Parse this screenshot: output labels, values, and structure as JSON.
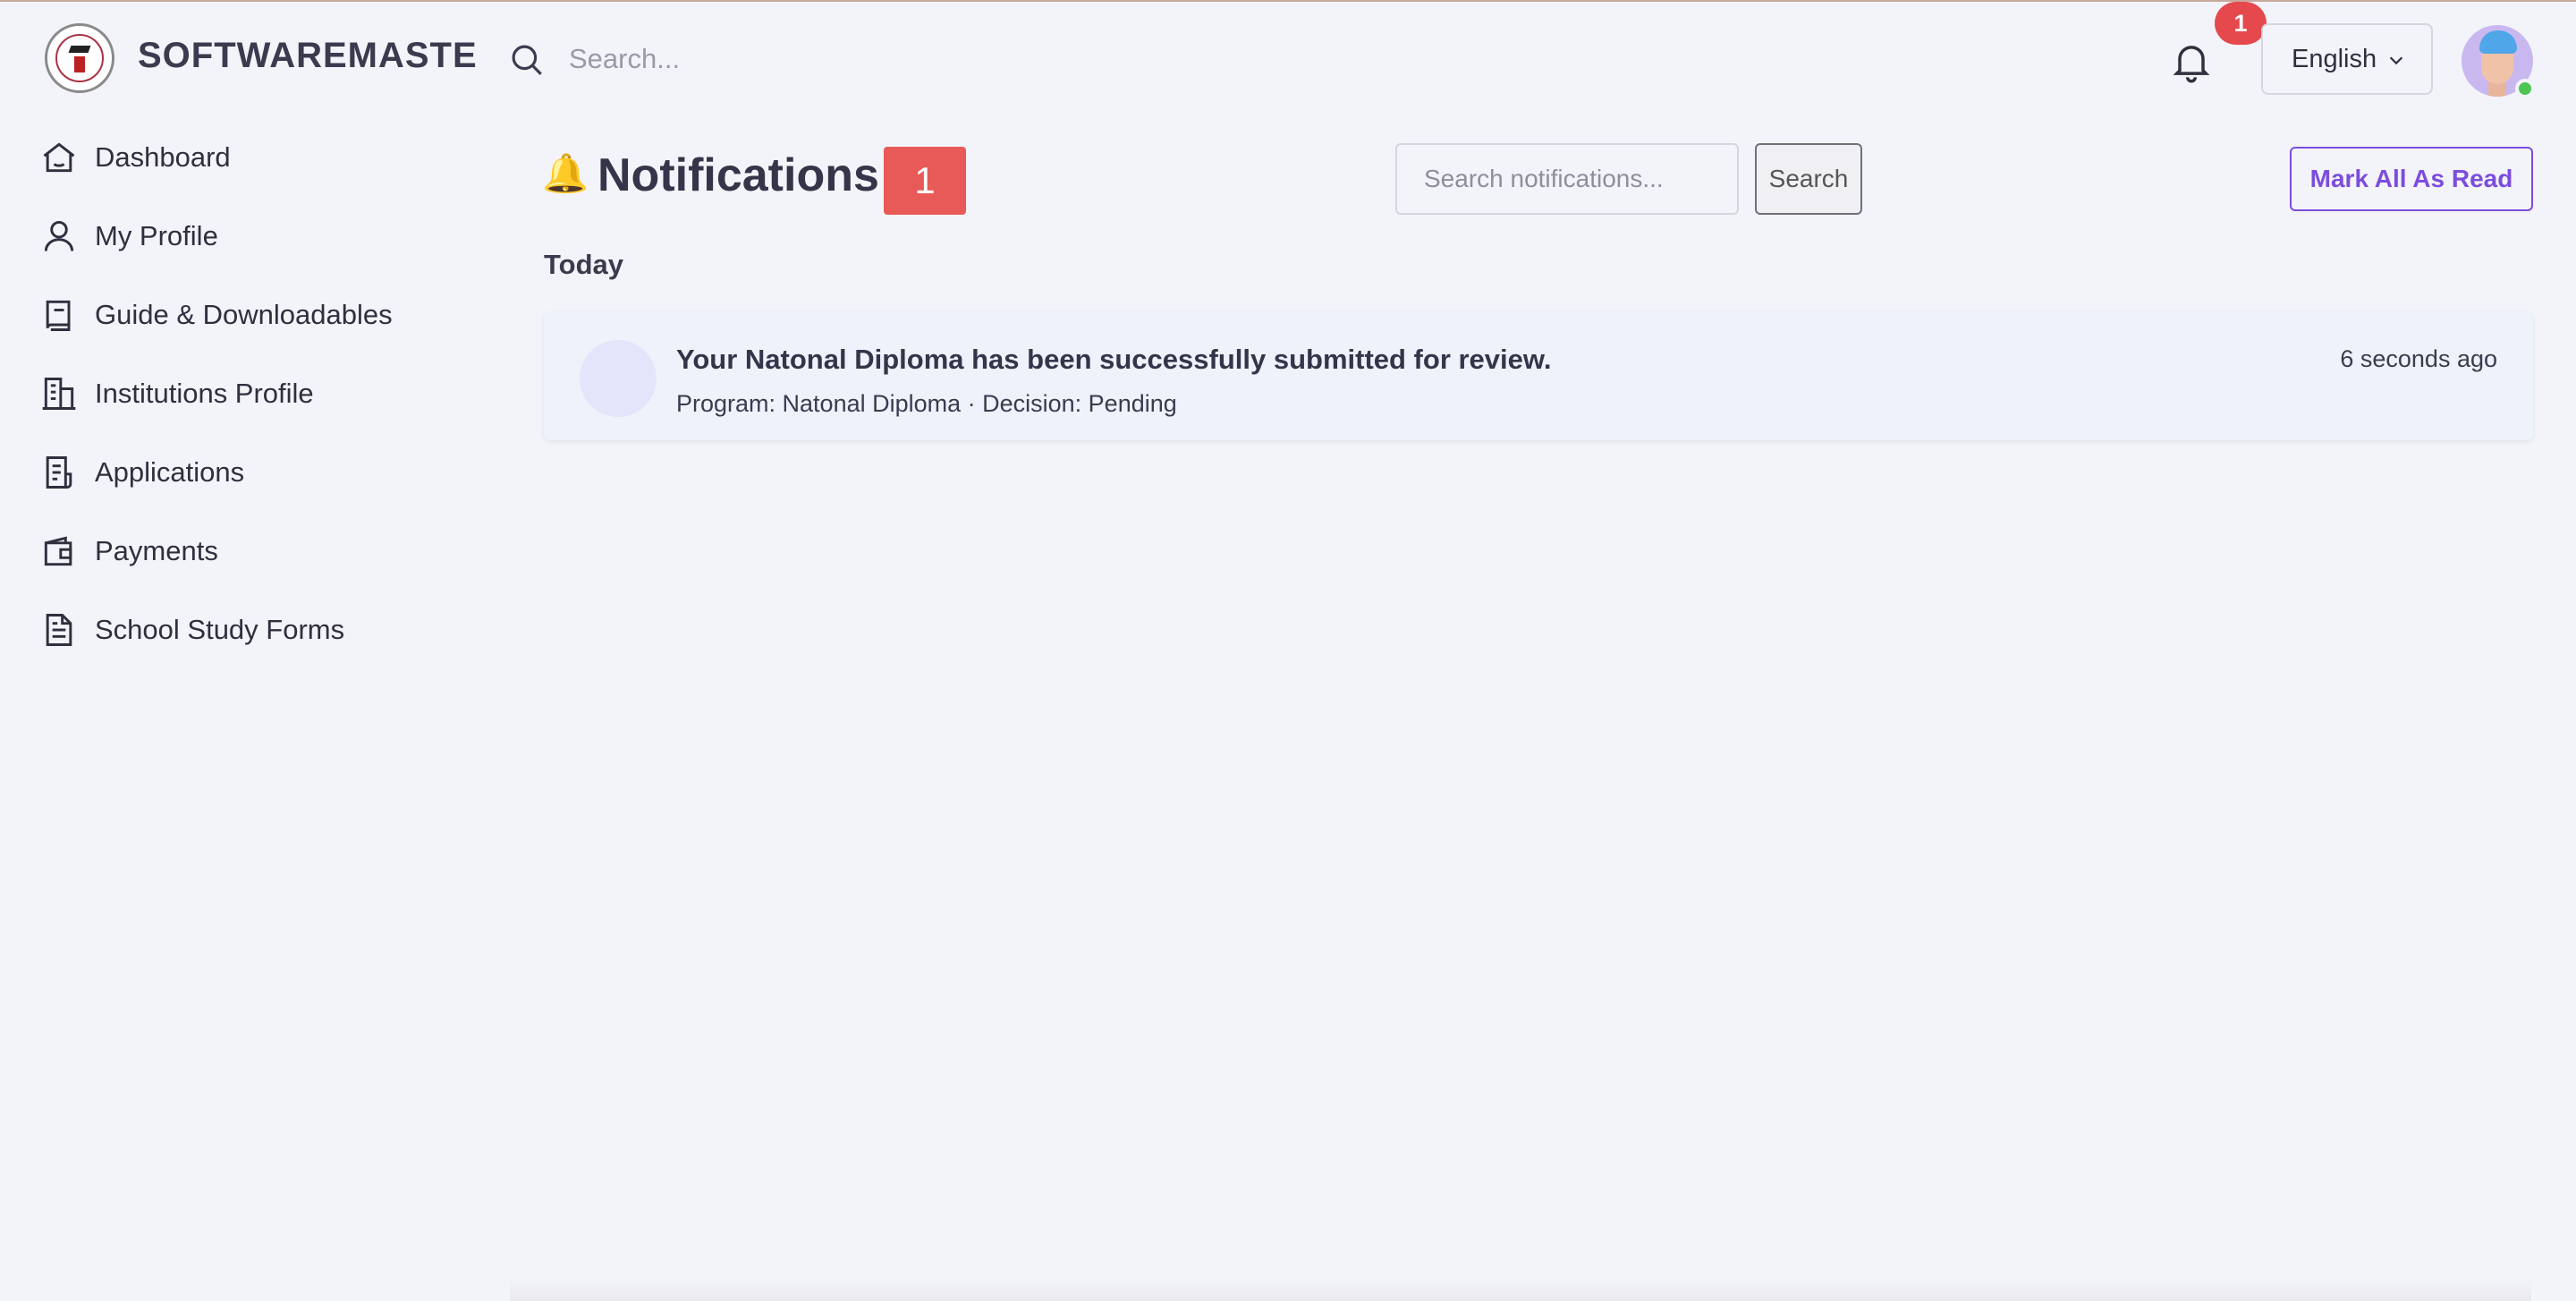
{
  "brand": {
    "name": "SOFTWAREMASTE",
    "logo_icon": "school-seal-logo"
  },
  "top_search": {
    "placeholder": "Search...",
    "icon": "search-icon"
  },
  "notifications_badge": {
    "count": "1",
    "icon": "bell-icon",
    "color": "#e5484d"
  },
  "language": {
    "selected": "English",
    "icon": "chevron-down-icon"
  },
  "user": {
    "avatar": "avatar",
    "status": "online",
    "status_color": "#4cc552"
  },
  "sidebar": {
    "items": [
      {
        "label": "Dashboard",
        "icon": "home-icon"
      },
      {
        "label": "My Profile",
        "icon": "user-icon"
      },
      {
        "label": "Guide & Downloadables",
        "icon": "book-icon"
      },
      {
        "label": "Institutions Profile",
        "icon": "building-icon"
      },
      {
        "label": "Applications",
        "icon": "document-list-icon"
      },
      {
        "label": "Payments",
        "icon": "wallet-icon"
      },
      {
        "label": "School Study Forms",
        "icon": "file-text-icon"
      }
    ]
  },
  "main": {
    "title_emoji": "🔔",
    "title": "Notifications",
    "title_count": "1",
    "search_placeholder": "Search notifications...",
    "search_button": "Search",
    "mark_all_button": "Mark All As Read",
    "accent_color": "#7c4ddc",
    "groups": [
      {
        "label": "Today",
        "items": [
          {
            "title": "Your Natonal Diploma has been successfully submitted for review.",
            "subtitle": "Program: Natonal Diploma · Decision: Pending",
            "time": "6 seconds ago"
          }
        ]
      }
    ]
  }
}
